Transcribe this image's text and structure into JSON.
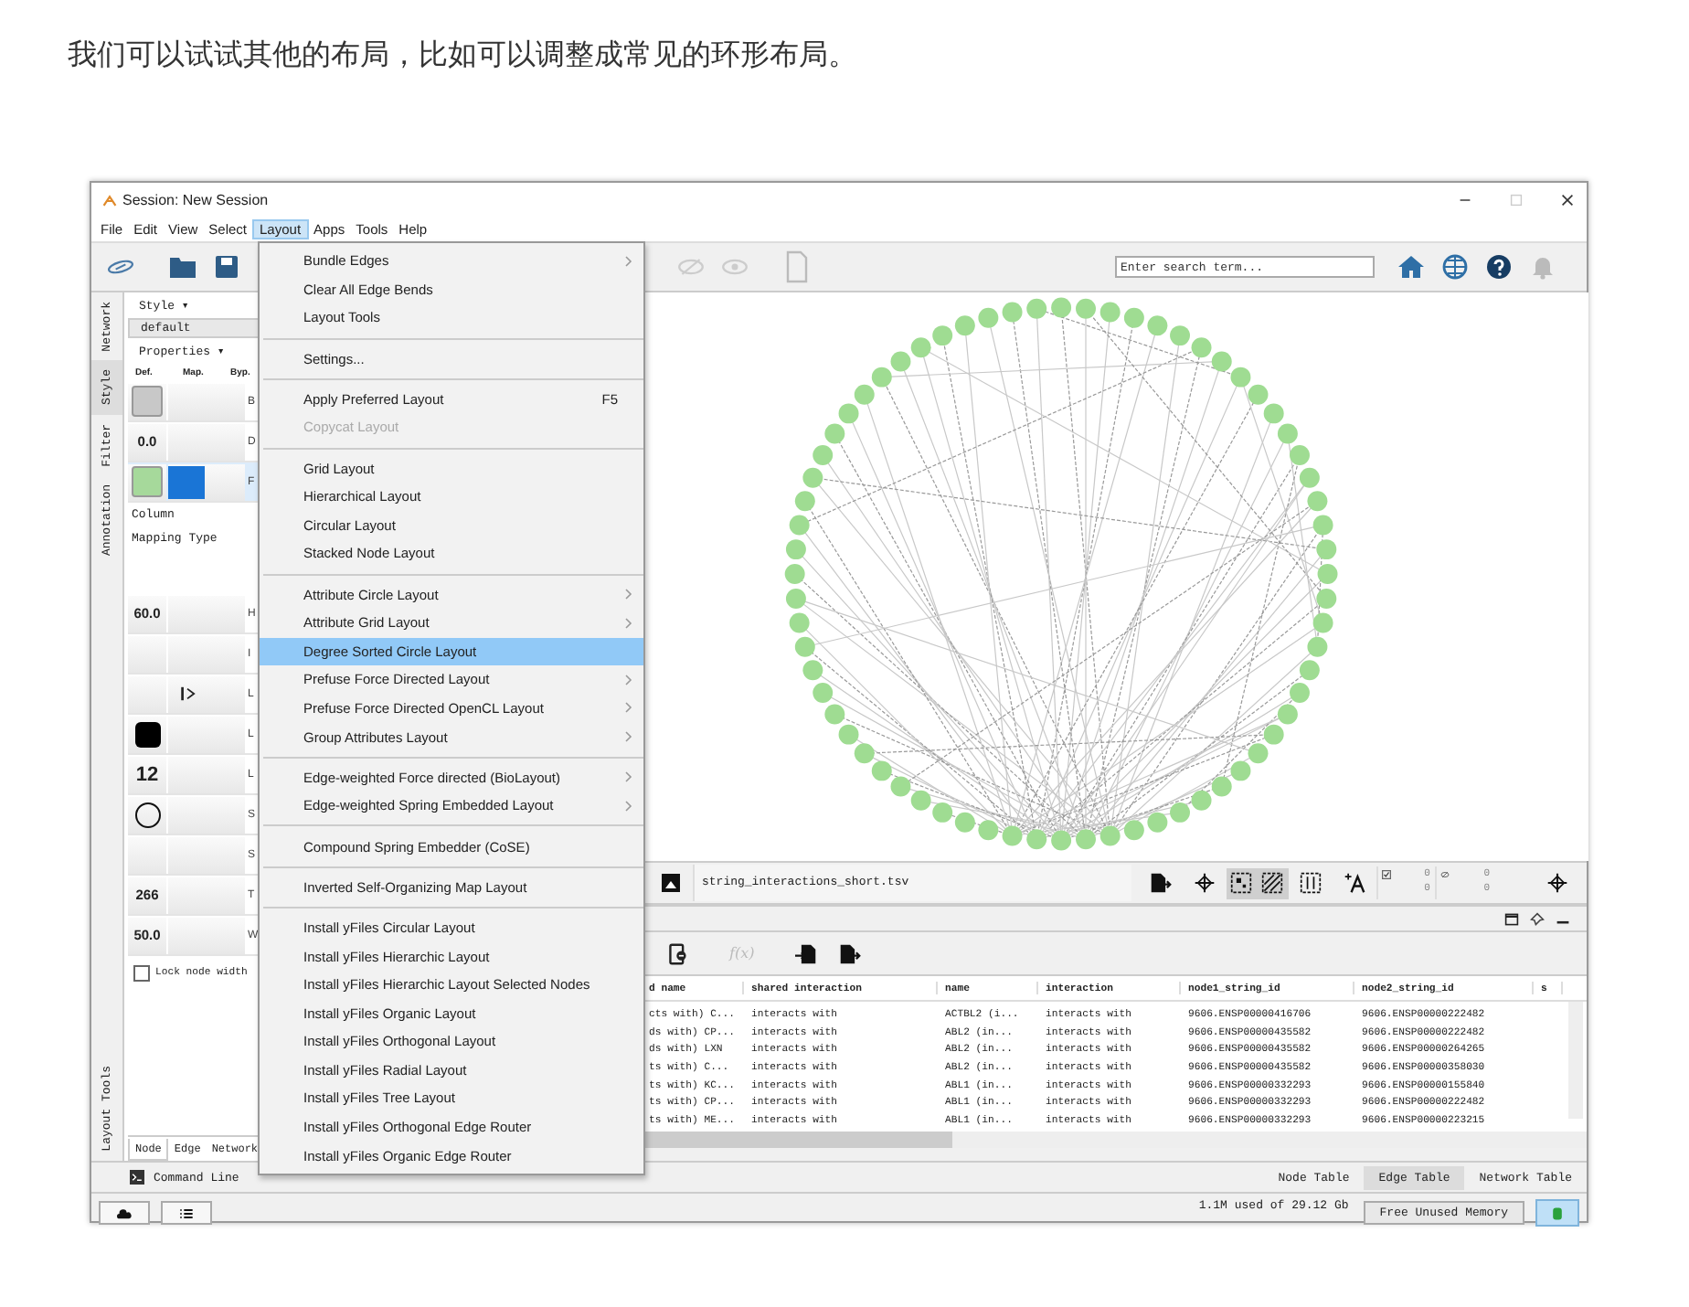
{
  "article_text": "我们可以试试其他的布局，比如可以调整成常见的环形布局。",
  "window": {
    "title": "Session: New Session"
  },
  "menubar": [
    {
      "label": "File",
      "selected": false
    },
    {
      "label": "Edit",
      "selected": false
    },
    {
      "label": "View",
      "selected": false
    },
    {
      "label": "Select",
      "selected": false
    },
    {
      "label": "Layout",
      "selected": true
    },
    {
      "label": "Apps",
      "selected": false
    },
    {
      "label": "Tools",
      "selected": false
    },
    {
      "label": "Help",
      "selected": false
    }
  ],
  "search": {
    "placeholder": "Enter search term..."
  },
  "side_tabs": [
    {
      "label": "Network",
      "selected": false
    },
    {
      "label": "Style",
      "selected": true
    },
    {
      "label": "Filter",
      "selected": false
    },
    {
      "label": "Annotation",
      "selected": false
    }
  ],
  "side_tabs_bottom": {
    "label": "Layout Tools"
  },
  "style_panel": {
    "style_label": "Style ▾",
    "style_value": "default",
    "properties_label": "Properties ▾",
    "columns": [
      "Def.",
      "Map.",
      "Byp."
    ],
    "top_rows": [
      {
        "kind": "swatch",
        "color": "#c8c8c8",
        "label": "B",
        "selected": false
      },
      {
        "kind": "number",
        "value": "0.0",
        "label": "D",
        "selected": false
      },
      {
        "kind": "swatch",
        "color": "#a6d99b",
        "mapping": {
          "color": "#1a75d6"
        },
        "label": "F",
        "selected": true
      }
    ],
    "column_label": "Column",
    "mapping_label": "Mapping Type",
    "rows": [
      {
        "kind": "number",
        "value": "60.0",
        "label": "H"
      },
      {
        "kind": "empty",
        "label": "I"
      },
      {
        "kind": "arrow",
        "label": "L"
      },
      {
        "kind": "square",
        "label": "L"
      },
      {
        "kind": "number",
        "value": "12",
        "large": true,
        "label": "L"
      },
      {
        "kind": "circle",
        "label": "S"
      },
      {
        "kind": "empty",
        "label": "S"
      },
      {
        "kind": "number",
        "value": "266",
        "label": "T"
      },
      {
        "kind": "number",
        "value": "50.0",
        "label": "W"
      }
    ],
    "lock": {
      "label": "Lock node width",
      "checked": false
    },
    "bottom_tabs": [
      {
        "label": "Node",
        "selected": true
      },
      {
        "label": "Edge",
        "selected": false
      },
      {
        "label": "Network",
        "selected": false
      }
    ]
  },
  "layout_menu": [
    {
      "kind": "item",
      "label": "Bundle Edges",
      "submenu": true,
      "disabled": false,
      "selected": false
    },
    {
      "kind": "item",
      "label": "Clear All Edge Bends",
      "submenu": false,
      "disabled": false,
      "selected": false
    },
    {
      "kind": "item",
      "label": "Layout Tools",
      "submenu": false,
      "disabled": false,
      "selected": false
    },
    {
      "kind": "separator"
    },
    {
      "kind": "item",
      "label": "Settings...",
      "submenu": false,
      "disabled": false,
      "selected": false
    },
    {
      "kind": "separator"
    },
    {
      "kind": "item",
      "label": "Apply Preferred Layout",
      "shortcut": "F5",
      "submenu": false,
      "disabled": false,
      "selected": false
    },
    {
      "kind": "item",
      "label": "Copycat Layout",
      "submenu": false,
      "disabled": true,
      "selected": false
    },
    {
      "kind": "separator"
    },
    {
      "kind": "item",
      "label": "Grid Layout",
      "submenu": false,
      "disabled": false,
      "selected": false
    },
    {
      "kind": "item",
      "label": "Hierarchical Layout",
      "submenu": false,
      "disabled": false,
      "selected": false
    },
    {
      "kind": "item",
      "label": "Circular Layout",
      "submenu": false,
      "disabled": false,
      "selected": false
    },
    {
      "kind": "item",
      "label": "Stacked Node Layout",
      "submenu": false,
      "disabled": false,
      "selected": false
    },
    {
      "kind": "separator"
    },
    {
      "kind": "item",
      "label": "Attribute Circle Layout",
      "submenu": true,
      "disabled": false,
      "selected": false
    },
    {
      "kind": "item",
      "label": "Attribute Grid Layout",
      "submenu": true,
      "disabled": false,
      "selected": false
    },
    {
      "kind": "item",
      "label": "Degree Sorted Circle Layout",
      "submenu": false,
      "disabled": false,
      "selected": true
    },
    {
      "kind": "item",
      "label": "Prefuse Force Directed Layout",
      "submenu": true,
      "disabled": false,
      "selected": false
    },
    {
      "kind": "item",
      "label": "Prefuse Force Directed OpenCL Layout",
      "submenu": true,
      "disabled": false,
      "selected": false
    },
    {
      "kind": "item",
      "label": "Group Attributes Layout",
      "submenu": true,
      "disabled": false,
      "selected": false
    },
    {
      "kind": "separator"
    },
    {
      "kind": "item",
      "label": "Edge-weighted Force directed (BioLayout)",
      "submenu": true,
      "disabled": false,
      "selected": false
    },
    {
      "kind": "item",
      "label": "Edge-weighted Spring Embedded Layout",
      "submenu": true,
      "disabled": false,
      "selected": false
    },
    {
      "kind": "separator"
    },
    {
      "kind": "item",
      "label": "Compound Spring Embedder (CoSE)",
      "submenu": false,
      "disabled": false,
      "selected": false
    },
    {
      "kind": "separator"
    },
    {
      "kind": "item",
      "label": "Inverted Self-Organizing Map Layout",
      "submenu": false,
      "disabled": false,
      "selected": false
    },
    {
      "kind": "separator"
    },
    {
      "kind": "item",
      "label": "Install yFiles Circular Layout",
      "submenu": false,
      "disabled": false,
      "selected": false
    },
    {
      "kind": "item",
      "label": "Install yFiles Hierarchic Layout",
      "submenu": false,
      "disabled": false,
      "selected": false
    },
    {
      "kind": "item",
      "label": "Install yFiles Hierarchic Layout Selected Nodes",
      "submenu": false,
      "disabled": false,
      "selected": false
    },
    {
      "kind": "item",
      "label": "Install yFiles Organic Layout",
      "submenu": false,
      "disabled": false,
      "selected": false
    },
    {
      "kind": "item",
      "label": "Install yFiles Orthogonal Layout",
      "submenu": false,
      "disabled": false,
      "selected": false
    },
    {
      "kind": "item",
      "label": "Install yFiles Radial Layout",
      "submenu": false,
      "disabled": false,
      "selected": false
    },
    {
      "kind": "item",
      "label": "Install yFiles Tree Layout",
      "submenu": false,
      "disabled": false,
      "selected": false
    },
    {
      "kind": "item",
      "label": "Install yFiles Orthogonal Edge Router",
      "submenu": false,
      "disabled": false,
      "selected": false
    },
    {
      "kind": "item",
      "label": "Install yFiles Organic Edge Router",
      "submenu": false,
      "disabled": false,
      "selected": false
    }
  ],
  "network_toolbar": {
    "filename": "string_interactions_short.tsv",
    "toggles": [
      {
        "selected": true
      },
      {
        "selected": true
      }
    ],
    "selected_counts": [
      "0",
      "0"
    ],
    "hidden_counts": [
      "0",
      "0"
    ]
  },
  "table_toolbar": {
    "function_label": "f(x)"
  },
  "table": {
    "columns": [
      "d name",
      "shared interaction",
      "name",
      "interaction",
      "node1_string_id",
      "node2_string_id",
      "s"
    ],
    "rows": [
      [
        "cts with) C...",
        "interacts with",
        "ACTBL2 (i...",
        "interacts with",
        "9606.ENSP00000416706",
        "9606.ENSP00000222482"
      ],
      [
        "ds with) CP...",
        "interacts with",
        "ABL2 (in...",
        "interacts with",
        "9606.ENSP00000435582",
        "9606.ENSP00000222482"
      ],
      [
        "ds with) LXN",
        "interacts with",
        "ABL2 (in...",
        "interacts with",
        "9606.ENSP00000435582",
        "9606.ENSP00000264265"
      ],
      [
        "ts with) C...",
        "interacts with",
        "ABL2 (in...",
        "interacts with",
        "9606.ENSP00000435582",
        "9606.ENSP00000358030"
      ],
      [
        "ts with) KC...",
        "interacts with",
        "ABL1 (in...",
        "interacts with",
        "9606.ENSP00000332293",
        "9606.ENSP00000155840"
      ],
      [
        "ts with) CP...",
        "interacts with",
        "ABL1 (in...",
        "interacts with",
        "9606.ENSP00000332293",
        "9606.ENSP00000222482"
      ],
      [
        "ts with) ME...",
        "interacts with",
        "ABL1 (in...",
        "interacts with",
        "9606.ENSP00000332293",
        "9606.ENSP00000223215"
      ]
    ]
  },
  "command_line": {
    "label": "Command Line"
  },
  "table_tabs": [
    {
      "label": "Node Table",
      "selected": false
    },
    {
      "label": "Edge Table",
      "selected": true
    },
    {
      "label": "Network Table",
      "selected": false
    }
  ],
  "status_bar": {
    "memory": "1.1M used of 29.12 Gb",
    "free_button": "Free Unused Memory"
  }
}
